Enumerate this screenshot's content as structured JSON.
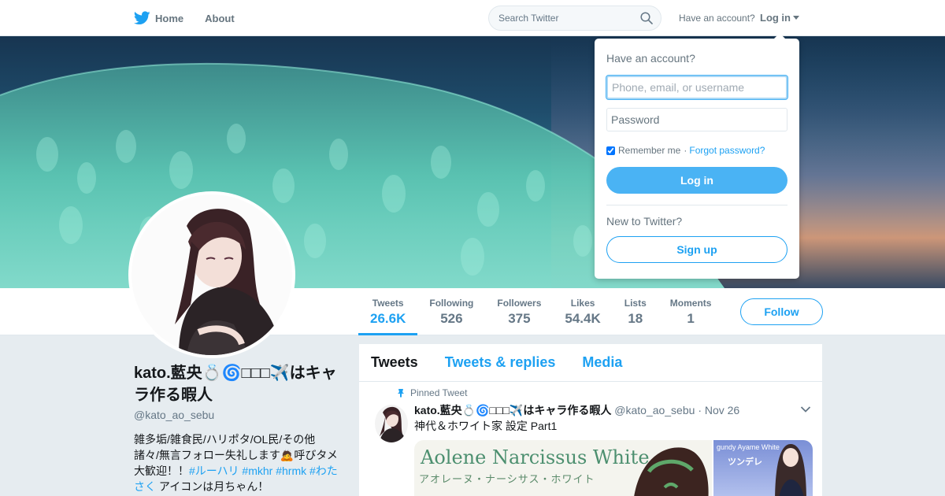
{
  "nav": {
    "home_label": "Home",
    "about_label": "About",
    "search_placeholder": "Search Twitter",
    "have_account": "Have an account?",
    "login_label": "Log in"
  },
  "colors": {
    "accent": "#1da1f2",
    "login_button": "#4ab3f4",
    "text_secondary": "#657786"
  },
  "profile": {
    "name": "kato.藍央💍🌀□□□✈️はキャラ作る暇人",
    "handle": "@kato_ao_sebu",
    "bio_text_1": "雑多垢/雑食民/ハリポタ/OL民/その他諸々/無言フォロー失礼します🙇呼びタメ大歓迎！！",
    "bio_tag_1": "#ルーハリ",
    "bio_tag_2": "#mkhr",
    "bio_tag_3": "#hrmk",
    "bio_tag_4": "#わたさく",
    "bio_text_2": " アイコンは月ちゃん！"
  },
  "stats": [
    {
      "label": "Tweets",
      "value": "26.6K"
    },
    {
      "label": "Following",
      "value": "526"
    },
    {
      "label": "Followers",
      "value": "375"
    },
    {
      "label": "Likes",
      "value": "54.4K"
    },
    {
      "label": "Lists",
      "value": "18"
    },
    {
      "label": "Moments",
      "value": "1"
    }
  ],
  "follow_label": "Follow",
  "timeline": {
    "tabs": [
      "Tweets",
      "Tweets & replies",
      "Media"
    ],
    "pinned_label": "Pinned Tweet",
    "tweet": {
      "name": "kato.藍央💍🌀□□□✈️はキャラ作る暇人",
      "handle": "@kato_ao_sebu",
      "date": "· Nov 26",
      "text": "神代＆ホワイト家 設定 Part1",
      "media_title": "Aolene Narcissus White",
      "media_subtitle": "アオレーヌ・ナーシサス・ホワイト",
      "media_side_title": "gundy Ayame White",
      "media_side_subtitle": "ツンデレ"
    }
  },
  "login_dropdown": {
    "heading": "Have an account?",
    "username_placeholder": "Phone, email, or username",
    "password_placeholder": "Password",
    "remember_label": "Remember me",
    "separator": "·",
    "forgot_label": "Forgot password?",
    "login_button": "Log in",
    "new_to": "New to Twitter?",
    "signup_button": "Sign up"
  }
}
